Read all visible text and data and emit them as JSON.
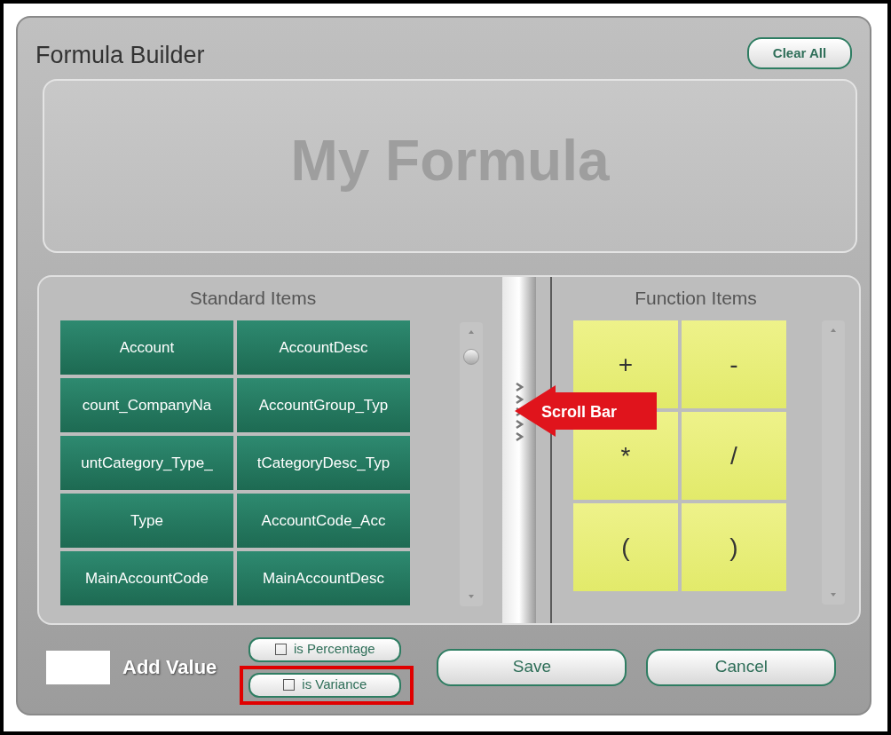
{
  "dialog": {
    "title": "Formula Builder",
    "clear_button": "Clear All",
    "formula": {
      "placeholder": "My Formula"
    },
    "standard_items": {
      "heading": "Standard Items",
      "items": [
        "Account",
        "AccountDesc",
        "count_CompanyNa",
        "AccountGroup_Typ",
        "untCategory_Type_",
        "tCategoryDesc_Typ",
        "Type",
        "AccountCode_Acc",
        "MainAccountCode",
        "MainAccountDesc"
      ]
    },
    "function_items": {
      "heading": "Function Items",
      "items": [
        "+",
        "-",
        "*",
        "/",
        "(",
        ")"
      ]
    },
    "add_value": {
      "label": "Add Value"
    },
    "options": [
      {
        "label": "is Percentage",
        "checked": false,
        "highlighted": false
      },
      {
        "label": "is Variance",
        "checked": false,
        "highlighted": true
      }
    ],
    "buttons": [
      "Save",
      "Cancel"
    ]
  },
  "callout": {
    "text": "Scroll Bar"
  }
}
